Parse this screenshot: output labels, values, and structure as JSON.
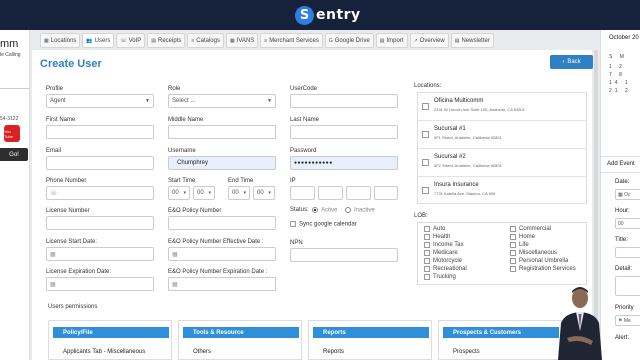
{
  "brand": {
    "logo_letter": "S",
    "logo_text": "entry"
  },
  "left_panel": {
    "company_fragment": "mm",
    "tagline_fragment": "le Calling",
    "phone_fragment": "54-3122",
    "youtube_label": "You Tube",
    "go_label": "Go!"
  },
  "tabs": [
    {
      "icon": "building-icon",
      "glyph": "▦",
      "label": "Locations"
    },
    {
      "icon": "users-icon",
      "glyph": "👥",
      "label": "Users"
    },
    {
      "icon": "phone-icon",
      "glyph": "☏",
      "label": "VoIP"
    },
    {
      "icon": "receipt-icon",
      "glyph": "▤",
      "label": "Receipts"
    },
    {
      "icon": "list-icon",
      "glyph": "≡",
      "label": "Catalogs"
    },
    {
      "icon": "grid-icon",
      "glyph": "▦",
      "label": "IVANS"
    },
    {
      "icon": "list-icon",
      "glyph": "≡",
      "label": "Merchant Services"
    },
    {
      "icon": "google-icon",
      "glyph": "G",
      "label": "Google Drive"
    },
    {
      "icon": "import-icon",
      "glyph": "▤",
      "label": "Import"
    },
    {
      "icon": "chart-icon",
      "glyph": "↗",
      "label": "Overview"
    },
    {
      "icon": "newsletter-icon",
      "glyph": "▤",
      "label": "Newsletter"
    }
  ],
  "page": {
    "title": "Create User",
    "back_label": "Back",
    "back_icon": "‹"
  },
  "form": {
    "profile": {
      "label": "Profile",
      "value": "Agent"
    },
    "role": {
      "label": "Role",
      "placeholder": "Select ..."
    },
    "usercode": {
      "label": "UserCode",
      "value": ""
    },
    "first_name": {
      "label": "First Name",
      "value": ""
    },
    "middle_name": {
      "label": "Middle Name",
      "value": ""
    },
    "last_name": {
      "label": "Last Name",
      "value": ""
    },
    "email": {
      "label": "Email",
      "value": ""
    },
    "username": {
      "label": "Username",
      "value": "Chumphrey"
    },
    "password": {
      "label": "Password",
      "value": "●●●●●●●●●●●"
    },
    "phone": {
      "label": "Phone Number",
      "icon": "phone-icon"
    },
    "start_time": {
      "label": "Start Time",
      "hour": "00",
      "minute": "00"
    },
    "end_time": {
      "label": "End Time",
      "hour": "00",
      "minute": "00"
    },
    "ip": {
      "label": "IP"
    },
    "license_number": {
      "label": "License Number"
    },
    "eo_policy_number": {
      "label": "E&O Policy Number"
    },
    "status": {
      "label": "Status:",
      "active": "Active",
      "inactive": "Inactive",
      "selected": "Active"
    },
    "sync_google": {
      "label": "Sync google calendar"
    },
    "license_start": {
      "label": "License Start Date:"
    },
    "eo_effective": {
      "label": "E&O Policy Number  Effective Date :"
    },
    "npn": {
      "label": "NPN"
    },
    "license_expiration": {
      "label": "License Expiration Date:"
    },
    "eo_expiration": {
      "label": "E&O Policy Number  Expiration Date :"
    }
  },
  "locations": {
    "label": "Locations:",
    "items": [
      {
        "name": "Oficina Multicomm",
        "address": "2331 W Lincoln Ave Suite 100, Anaheim, CA 92801"
      },
      {
        "name": "Sucursal #1",
        "address": "0F1 Street, Anaheim, California 92801"
      },
      {
        "name": "Sucursal #2",
        "address": "0F2 Street, Anaheim, California 92801"
      },
      {
        "name": "Insura Insurance",
        "address": "7731 Katella Ave, Stanton, CA 906"
      }
    ]
  },
  "lob": {
    "label": "LOB:",
    "col1": [
      "Auto",
      "Health",
      "Income Tax",
      "Medicare",
      "Motorcycle",
      "Recreational",
      "Trucking"
    ],
    "col2": [
      "Commercial",
      "Home",
      "Life",
      "Miscellaneous",
      "Personal Umbrella",
      "Registration Services"
    ]
  },
  "permissions": {
    "title": "Users permissions",
    "cards": [
      {
        "head": "Policy/File",
        "item": "Applicants Tab - Miscellaneous"
      },
      {
        "head": "Tools & Resource",
        "item": "Others"
      },
      {
        "head": "Reports",
        "item": "Reports"
      },
      {
        "head": "Prospects & Customers",
        "item": "Prospects"
      }
    ]
  },
  "right_panel": {
    "month": "October 20",
    "weekday_row": "S M",
    "day_rows": [
      "1 2",
      "7 8",
      "14 1",
      "21 2"
    ],
    "add_event": "Add Event",
    "date_label": "Date:",
    "date_value": "Oc",
    "hour_label": "Hour:",
    "hour_value": "00",
    "title_label": "Title:",
    "detail_label": "Detail:",
    "priority_label": "Priority",
    "priority_value": "Me",
    "alert_label": "Alert:"
  },
  "colors": {
    "topbar": "#16223b",
    "accent": "#2f80c5",
    "perm_head": "#2f8fd8",
    "filled_input": "#e8f0fe"
  }
}
